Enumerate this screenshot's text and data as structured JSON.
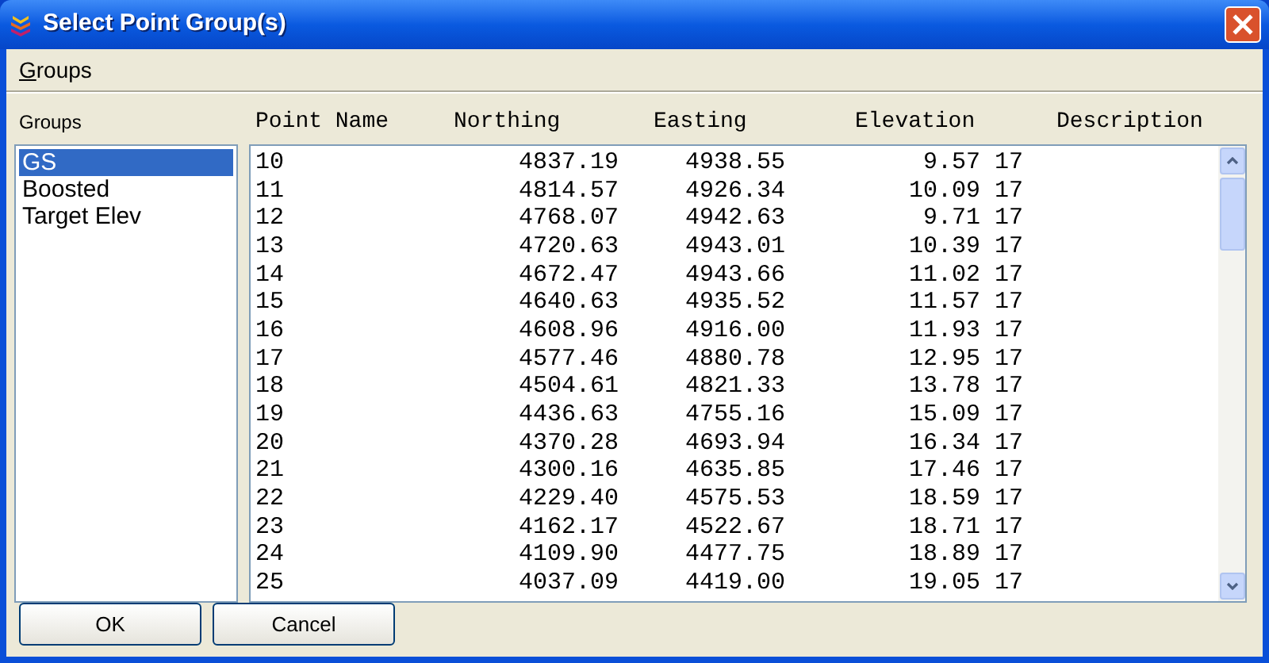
{
  "window": {
    "title": "Select Point Group(s)"
  },
  "menu": [
    {
      "label": "Groups"
    }
  ],
  "groups_panel": {
    "label": "Groups",
    "items": [
      {
        "label": "GS",
        "selected": true
      },
      {
        "label": "Boosted",
        "selected": false
      },
      {
        "label": "Target Elev",
        "selected": false
      }
    ]
  },
  "points": {
    "columns": [
      "Point Name",
      "Northing",
      "Easting",
      "Elevation",
      "Description"
    ],
    "rows": [
      {
        "point": "10",
        "northing": "4837.19",
        "easting": "4938.55",
        "elevation": "9.57",
        "description": "17"
      },
      {
        "point": "11",
        "northing": "4814.57",
        "easting": "4926.34",
        "elevation": "10.09",
        "description": "17"
      },
      {
        "point": "12",
        "northing": "4768.07",
        "easting": "4942.63",
        "elevation": "9.71",
        "description": "17"
      },
      {
        "point": "13",
        "northing": "4720.63",
        "easting": "4943.01",
        "elevation": "10.39",
        "description": "17"
      },
      {
        "point": "14",
        "northing": "4672.47",
        "easting": "4943.66",
        "elevation": "11.02",
        "description": "17"
      },
      {
        "point": "15",
        "northing": "4640.63",
        "easting": "4935.52",
        "elevation": "11.57",
        "description": "17"
      },
      {
        "point": "16",
        "northing": "4608.96",
        "easting": "4916.00",
        "elevation": "11.93",
        "description": "17"
      },
      {
        "point": "17",
        "northing": "4577.46",
        "easting": "4880.78",
        "elevation": "12.95",
        "description": "17"
      },
      {
        "point": "18",
        "northing": "4504.61",
        "easting": "4821.33",
        "elevation": "13.78",
        "description": "17"
      },
      {
        "point": "19",
        "northing": "4436.63",
        "easting": "4755.16",
        "elevation": "15.09",
        "description": "17"
      },
      {
        "point": "20",
        "northing": "4370.28",
        "easting": "4693.94",
        "elevation": "16.34",
        "description": "17"
      },
      {
        "point": "21",
        "northing": "4300.16",
        "easting": "4635.85",
        "elevation": "17.46",
        "description": "17"
      },
      {
        "point": "22",
        "northing": "4229.40",
        "easting": "4575.53",
        "elevation": "18.59",
        "description": "17"
      },
      {
        "point": "23",
        "northing": "4162.17",
        "easting": "4522.67",
        "elevation": "18.71",
        "description": "17"
      },
      {
        "point": "24",
        "northing": "4109.90",
        "easting": "4477.75",
        "elevation": "18.89",
        "description": "17"
      },
      {
        "point": "25",
        "northing": "4037.09",
        "easting": "4419.00",
        "elevation": "19.05",
        "description": "17"
      }
    ]
  },
  "buttons": [
    {
      "label": "OK"
    },
    {
      "label": "Cancel"
    }
  ]
}
